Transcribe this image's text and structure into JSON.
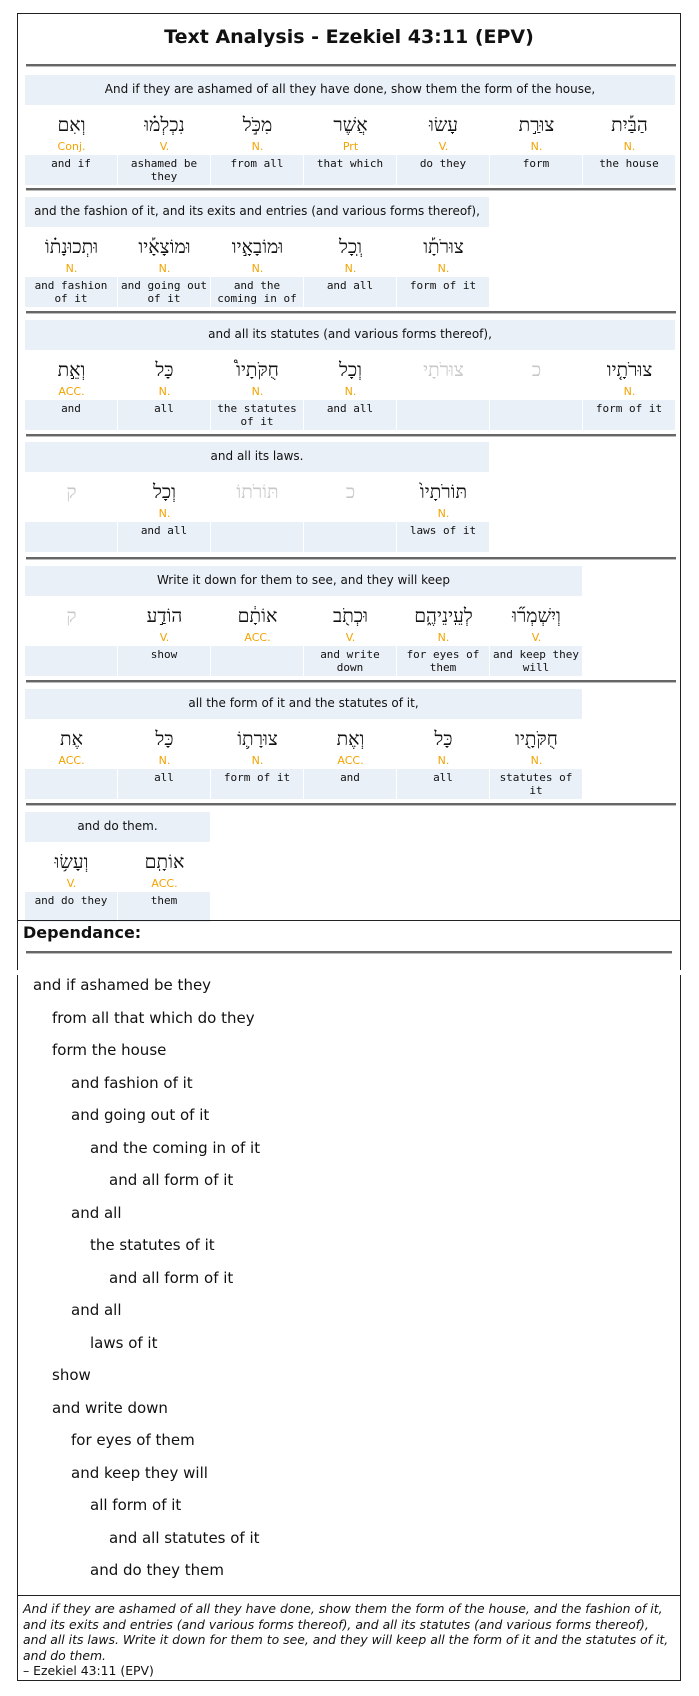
{
  "title": "Text Analysis - Ezekiel 43:11 (EPV)",
  "verses": [
    {
      "gloss": "And if they are ashamed of all they have done, show them the form of the house,",
      "words": [
        {
          "heb": "וְאִם",
          "pos": "Conj.",
          "eng": "and if",
          "ghost": false
        },
        {
          "heb": "נִכְלְמ֗וּ",
          "pos": "V.",
          "eng": "ashamed be they",
          "ghost": false
        },
        {
          "heb": "מִכֹּ֣ל",
          "pos": "N.",
          "eng": "from all",
          "ghost": false
        },
        {
          "heb": "אֲשֶׁר",
          "pos": "Prt",
          "eng": "that which",
          "ghost": false
        },
        {
          "heb": "עָשׂוּ",
          "pos": "V.",
          "eng": "do they",
          "ghost": false
        },
        {
          "heb": "צוּרַ֣ת",
          "pos": "N.",
          "eng": "form",
          "ghost": false
        },
        {
          "heb": "הַבַּ֡יִת",
          "pos": "N.",
          "eng": "the house",
          "ghost": false
        }
      ]
    },
    {
      "gloss": "and the fashion of it, and its exits and entries (and various forms thereof),",
      "words": [
        {
          "heb": "וּתְכוּנָת֗וֹ",
          "pos": "N.",
          "eng": "and fashion of it",
          "ghost": false
        },
        {
          "heb": "וּמוֹצָאָ֡יו",
          "pos": "N.",
          "eng": "and going out of it",
          "ghost": false
        },
        {
          "heb": "וּמוֹבָאָ֣יו",
          "pos": "N.",
          "eng": "and the coming in of",
          "ghost": false
        },
        {
          "heb": "וְֽכָל",
          "pos": "N.",
          "eng": "and all",
          "ghost": false
        },
        {
          "heb": "צוּרֹתָ֡ו",
          "pos": "N.",
          "eng": "form of it",
          "ghost": false
        }
      ]
    },
    {
      "gloss": "and all its statutes (and various forms thereof),",
      "words": [
        {
          "heb": "וְאֵ֣ת",
          "pos": "ACC.",
          "eng": "and",
          "ghost": false
        },
        {
          "heb": "כָּל",
          "pos": "N.",
          "eng": "all",
          "ghost": false
        },
        {
          "heb": "חֻקֹּתָיו֩",
          "pos": "N.",
          "eng": "the statutes of it",
          "ghost": false
        },
        {
          "heb": "וְכָל",
          "pos": "N.",
          "eng": "and all",
          "ghost": false
        },
        {
          "heb": "צוּרֹתָי",
          "pos": "",
          "eng": "",
          "ghost": true
        },
        {
          "heb": "כ",
          "pos": "",
          "eng": "",
          "ghost": true
        },
        {
          "heb": "צוּרֹתָ֤יו",
          "pos": "N.",
          "eng": "form of it",
          "ghost": false
        }
      ]
    },
    {
      "gloss": "and all its laws.",
      "words": [
        {
          "heb": "ק",
          "pos": "",
          "eng": "",
          "ghost": true
        },
        {
          "heb": "וְכָל",
          "pos": "N.",
          "eng": "and all",
          "ghost": false
        },
        {
          "heb": "תּוֹרֹתוֹ",
          "pos": "",
          "eng": "",
          "ghost": true
        },
        {
          "heb": "כ",
          "pos": "",
          "eng": "",
          "ghost": true
        },
        {
          "heb": "תּוֹרֹתָיו֙",
          "pos": "N.",
          "eng": "laws of it",
          "ghost": false
        }
      ]
    },
    {
      "gloss": "Write it down for them to see, and they will keep",
      "words": [
        {
          "heb": "ק",
          "pos": "",
          "eng": "",
          "ghost": true
        },
        {
          "heb": "הוֹדַ֣ע",
          "pos": "V.",
          "eng": "show",
          "ghost": false
        },
        {
          "heb": "אוֹתָ֔ם",
          "pos": "ACC.",
          "eng": "",
          "ghost": false
        },
        {
          "heb": "וּכְתֹ֖ב",
          "pos": "V.",
          "eng": "and write down",
          "ghost": false
        },
        {
          "heb": "לְעֵֽינֵיהֶ֑ם",
          "pos": "N.",
          "eng": "for eyes of them",
          "ghost": false
        },
        {
          "heb": "וְיִשְׁמְר֞וּ",
          "pos": "V.",
          "eng": "and keep they will",
          "ghost": false
        }
      ]
    },
    {
      "gloss": "all the form of it and the statutes of it,",
      "words": [
        {
          "heb": "אֶת",
          "pos": "ACC.",
          "eng": "",
          "ghost": false
        },
        {
          "heb": "כָּל",
          "pos": "N.",
          "eng": "all",
          "ghost": false
        },
        {
          "heb": "צוּרָת֛וֹ",
          "pos": "N.",
          "eng": "form of it",
          "ghost": false
        },
        {
          "heb": "וְאֶת",
          "pos": "ACC.",
          "eng": "and",
          "ghost": false
        },
        {
          "heb": "כָּל",
          "pos": "N.",
          "eng": "all",
          "ghost": false
        },
        {
          "heb": "חֻקֹּתָ֖יו",
          "pos": "N.",
          "eng": "statutes of it",
          "ghost": false
        }
      ]
    },
    {
      "gloss": "and do them.",
      "words": [
        {
          "heb": "וְעָשׂ֥וּ",
          "pos": "V.",
          "eng": "and do they",
          "ghost": false
        },
        {
          "heb": "אוֹתָֽם",
          "pos": "ACC.",
          "eng": "them",
          "ghost": false
        }
      ]
    }
  ],
  "dependance": {
    "heading": "Dependance:",
    "lines": [
      {
        "text": "and if ashamed be they",
        "level": 0
      },
      {
        "text": "from all that which do they",
        "level": 1
      },
      {
        "text": "form the house",
        "level": 1
      },
      {
        "text": "and fashion of it",
        "level": 2
      },
      {
        "text": "and going out of it",
        "level": 2
      },
      {
        "text": "and the coming in of it",
        "level": 3
      },
      {
        "text": "and all form of it",
        "level": 4
      },
      {
        "text": "and all",
        "level": 2
      },
      {
        "text": "the statutes of it",
        "level": 3
      },
      {
        "text": "and all form of it",
        "level": 4
      },
      {
        "text": "and all",
        "level": 2
      },
      {
        "text": "laws of it",
        "level": 3
      },
      {
        "text": "show",
        "level": 1
      },
      {
        "text": "and write down",
        "level": 1
      },
      {
        "text": "for eyes of them",
        "level": 2
      },
      {
        "text": "and keep they will",
        "level": 2
      },
      {
        "text": "all form of it",
        "level": 3
      },
      {
        "text": "and all statutes of it",
        "level": 4
      },
      {
        "text": "and do they them",
        "level": 3
      }
    ]
  },
  "quote": {
    "text": "And if they are ashamed of all they have done, show them the form of the house, and the fashion of it, and its exits and entries (and various forms thereof), and all its statutes (and various forms thereof), and all its laws. Write it down for them to see, and they will keep all the form of it and the statutes of it, and do them.",
    "citation": "– Ezekiel 43:11 (EPV)"
  },
  "colors": {
    "pos_label": "#f4a300",
    "row_background": "#eaf0f7",
    "ghost_word": "#c8c8c8"
  }
}
